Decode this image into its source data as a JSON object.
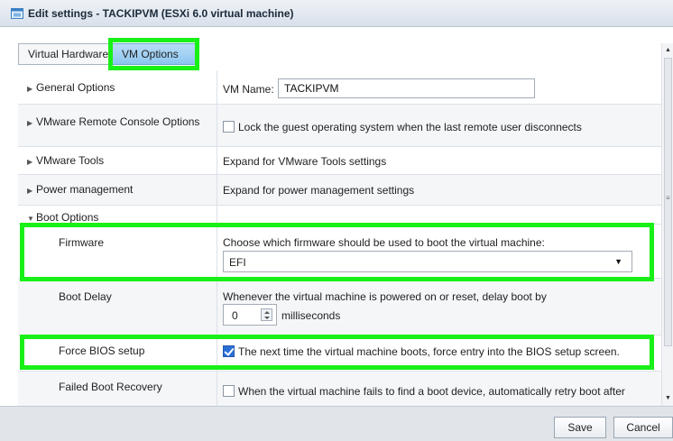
{
  "window": {
    "title": "Edit settings - TACKIPVM (ESXi 6.0 virtual machine)",
    "icon": "vm-settings-icon"
  },
  "tabs": [
    {
      "label": "Virtual Hardware",
      "active": false
    },
    {
      "label": "VM Options",
      "active": true
    }
  ],
  "rows": {
    "general": {
      "label": "General Options",
      "field_label": "VM Name:",
      "vm_name": "TACKIPVM"
    },
    "vmrc": {
      "label": "VMware Remote Console Options",
      "checkbox_text": "Lock the guest operating system when the last remote user disconnects",
      "checked": false
    },
    "tools": {
      "label": "VMware Tools",
      "value": "Expand for VMware Tools settings"
    },
    "power": {
      "label": "Power management",
      "value": "Expand for power management settings"
    },
    "boot": {
      "label": "Boot Options"
    },
    "firmware": {
      "label": "Firmware",
      "description": "Choose which firmware should be used to boot the virtual machine:",
      "selected": "EFI"
    },
    "boot_delay": {
      "label": "Boot Delay",
      "description": "Whenever the virtual machine is powered on or reset, delay boot by",
      "value": "0",
      "unit": "milliseconds"
    },
    "force_bios": {
      "label": "Force BIOS setup",
      "checkbox_text": "The next time the virtual machine boots, force entry into the BIOS setup screen.",
      "checked": true
    },
    "failed_boot": {
      "label": "Failed Boot Recovery",
      "checkbox_text": "When the virtual machine fails to find a boot device, automatically retry boot after",
      "checked": false
    }
  },
  "footer": {
    "save_label": "Save",
    "cancel_label": "Cancel"
  },
  "colors": {
    "highlight": "#18f018",
    "active_tab": "#8cc5f0",
    "title_bar": "#d8e0ea"
  }
}
